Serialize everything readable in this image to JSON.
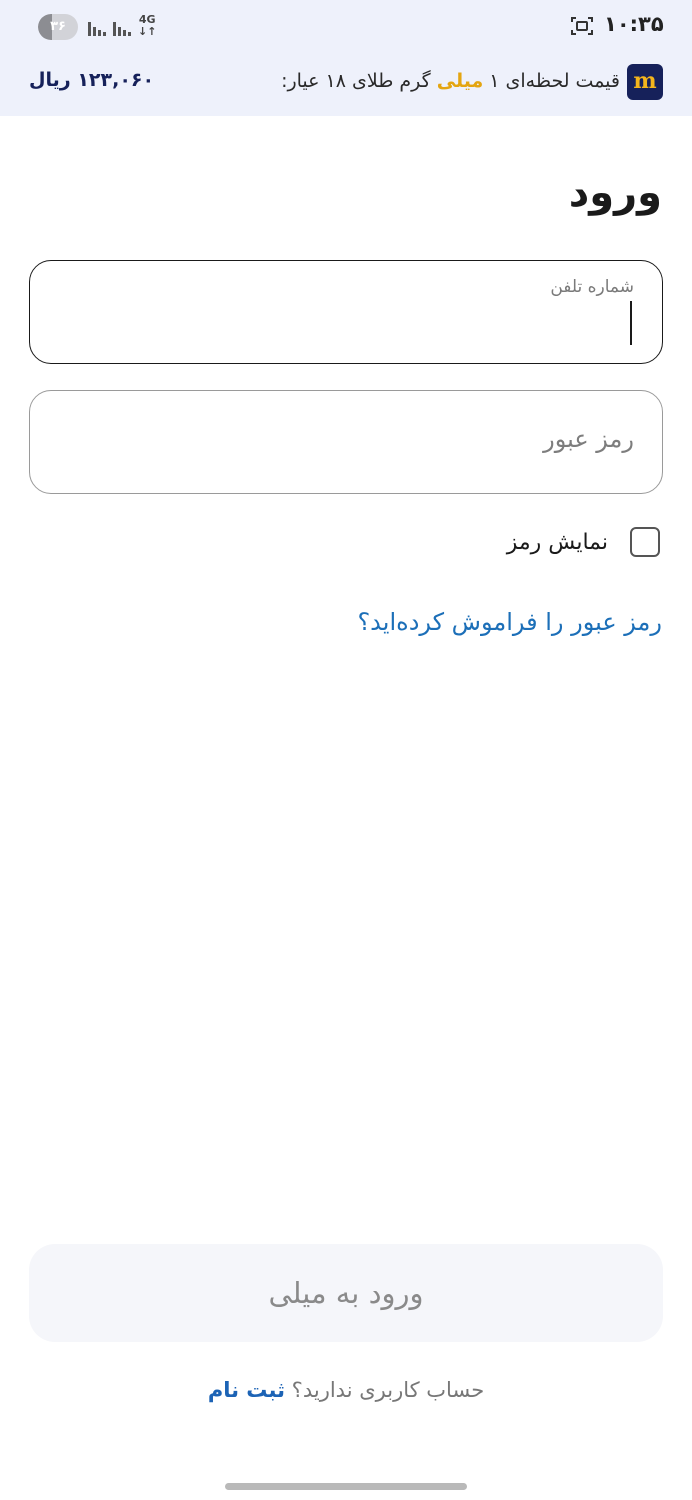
{
  "status_bar": {
    "time": "۱۰:۳۵",
    "battery": "۳۶",
    "battery_level": 0.36,
    "network": "4G",
    "icons": [
      "screenshot-icon",
      "signal-icon",
      "signal-icon",
      "battery-icon"
    ]
  },
  "price_banner": {
    "logo": "m",
    "label_prefix": "قیمت لحظه‌ای ۱ ",
    "brand": "میلی",
    "label_suffix": " گرم طلای ۱۸ عیار:",
    "value": "۱۲۳,۰۶۰ ریال",
    "brand_color": "#e4a511",
    "value_color": "#16215a"
  },
  "page": {
    "title": "ورود"
  },
  "form": {
    "phone": {
      "label": "شماره تلفن",
      "value": ""
    },
    "password": {
      "placeholder": "رمز عبور",
      "value": ""
    },
    "show_password": {
      "label": "نمایش رمز",
      "checked": false
    },
    "forgot_password": "رمز عبور را فراموش کرده‌اید؟",
    "submit": "ورود به میلی"
  },
  "signup": {
    "prompt": "حساب کاربری ندارید؟ ",
    "link": "ثبت نام"
  },
  "colors": {
    "link": "#1c6fb8",
    "banner_bg": "#eef1fb"
  }
}
